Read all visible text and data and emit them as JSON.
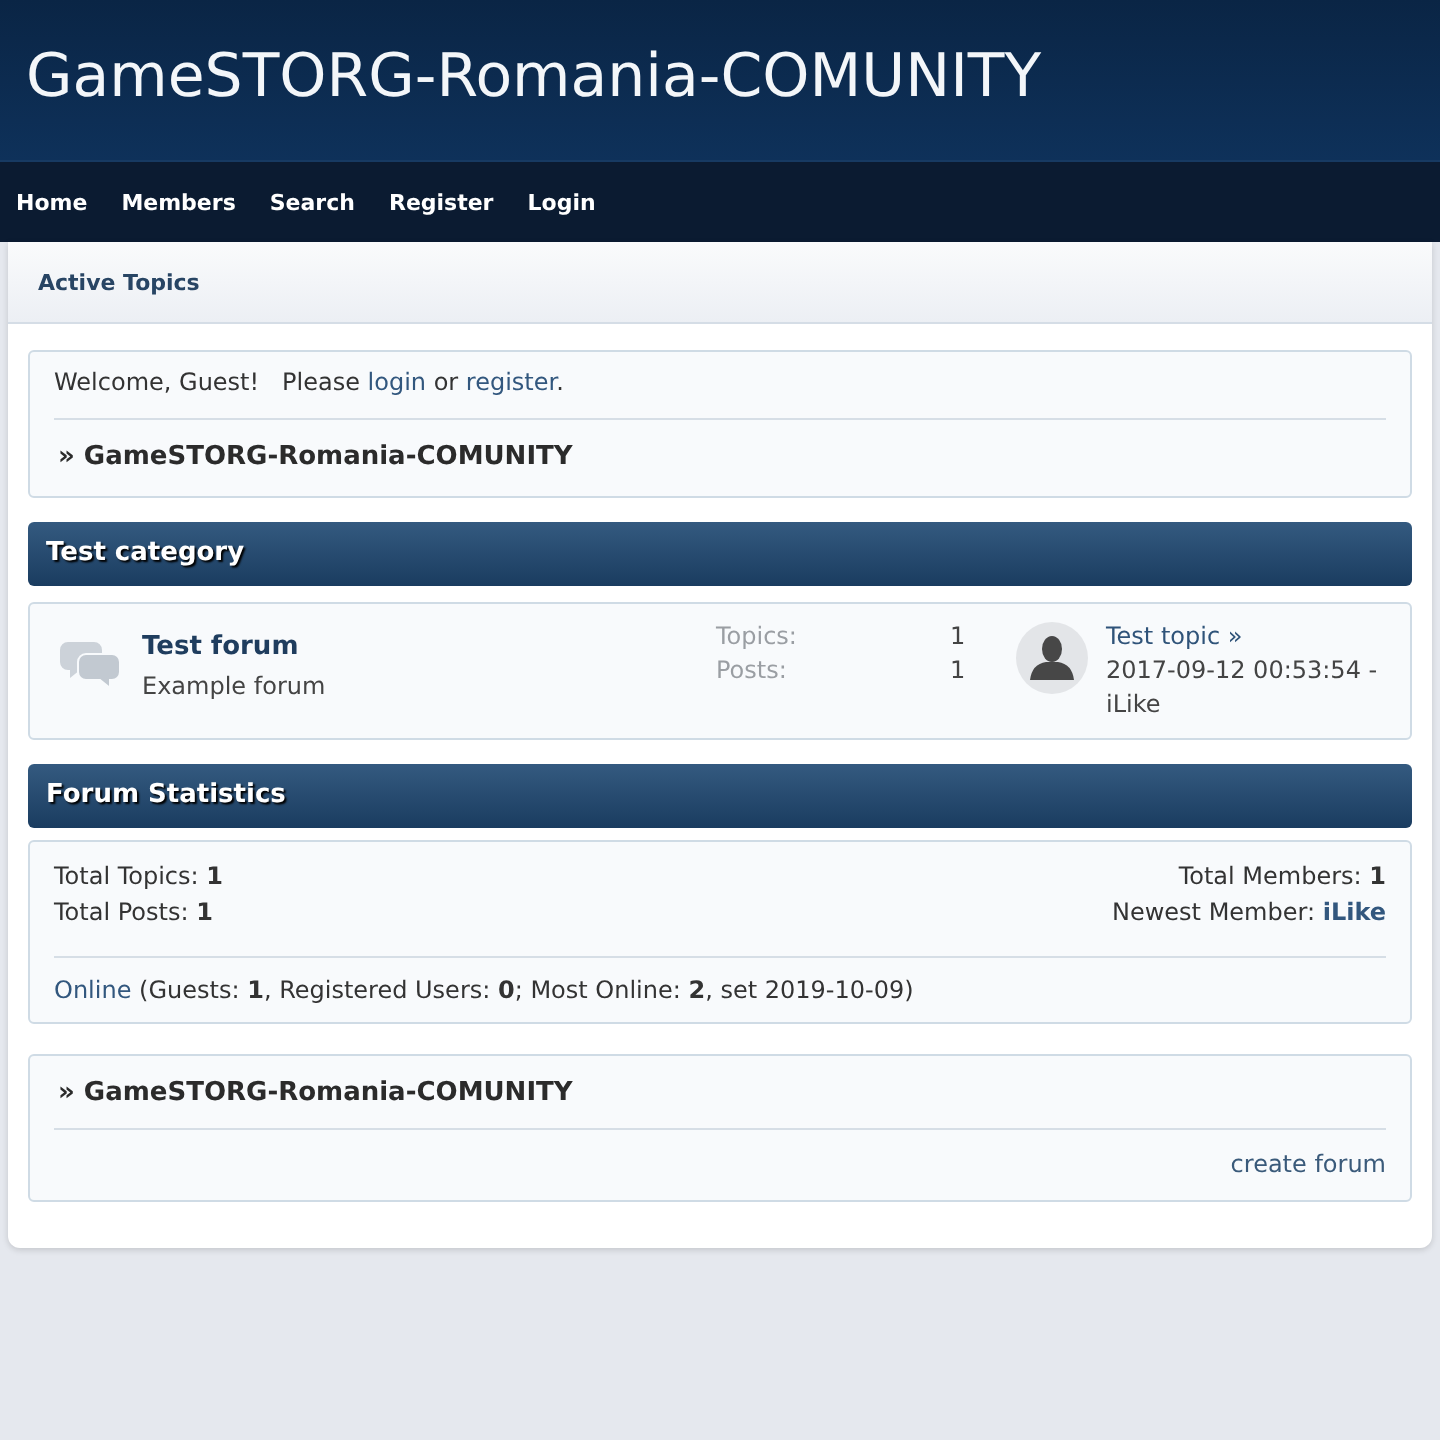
{
  "header": {
    "title": "GameSTORG-Romania-COMUNITY"
  },
  "nav": [
    {
      "label": "Home"
    },
    {
      "label": "Members"
    },
    {
      "label": "Search"
    },
    {
      "label": "Register"
    },
    {
      "label": "Login"
    }
  ],
  "subnav": [
    {
      "label": "Active Topics"
    }
  ],
  "welcome": {
    "message": [
      {
        "kind": "text",
        "text": "Welcome, Guest!   Please "
      },
      {
        "kind": "link",
        "text": "login"
      },
      {
        "kind": "text",
        "text": " or "
      },
      {
        "kind": "link",
        "text": "register"
      },
      {
        "kind": "text",
        "text": "."
      }
    ],
    "breadcrumb": "» GameSTORG-Romania-COMUNITY"
  },
  "categories": [
    {
      "title": "Test category",
      "forums": [
        {
          "name": "Test forum",
          "description": "Example forum",
          "stats": [
            {
              "label": "Topics:",
              "value": "1"
            },
            {
              "label": "Posts:",
              "value": "1"
            }
          ],
          "last_post": {
            "topic": "Test topic »",
            "date": "2017-09-12 00:53:54 -",
            "author": "iLike"
          }
        }
      ]
    }
  ],
  "statistics": {
    "title": "Forum Statistics",
    "left": [
      [
        {
          "kind": "text",
          "text": "Total Topics: **1**"
        }
      ],
      [
        {
          "kind": "text",
          "text": "Total Posts: **1**"
        }
      ]
    ],
    "right": [
      [
        {
          "kind": "text",
          "text": "Total Members: **1**"
        }
      ],
      [
        {
          "kind": "text",
          "text": "Newest Member: "
        },
        {
          "kind": "user",
          "text": "iLike"
        }
      ]
    ],
    "online": [
      {
        "kind": "link",
        "text": "Online"
      },
      {
        "kind": "text",
        "text": " (Guests: **1**, Registered Users: **0**; Most Online: **2**, set 2019-10-09)"
      }
    ]
  },
  "footer": {
    "breadcrumb": "» GameSTORG-Romania-COMUNITY",
    "links": [
      "create forum"
    ]
  }
}
